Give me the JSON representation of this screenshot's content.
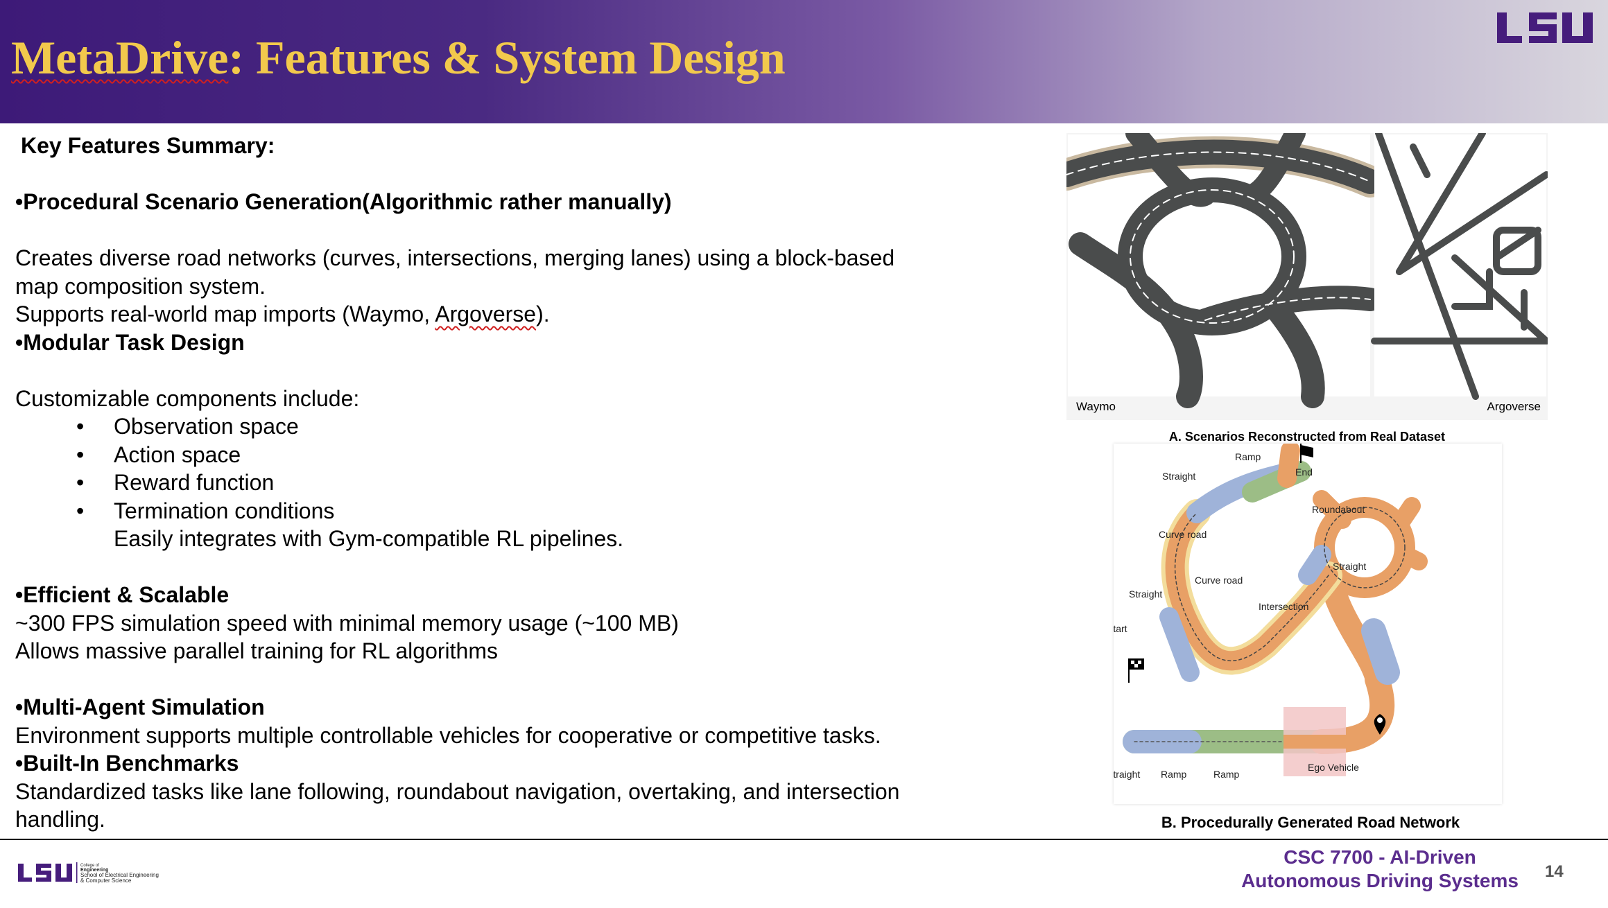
{
  "slide": {
    "title_main": "MetaDrive",
    "title_rest": ": Features & System Design",
    "page_number": "14"
  },
  "content": {
    "heading": "Key Features Summary:",
    "f1_title": "•Procedural Scenario Generation(Algorithmic rather manually)",
    "f1_line1": "Creates diverse road networks (curves, intersections, merging lanes) using a block-based",
    "f1_line2": "map composition system.",
    "f1_line3_pre": "Supports real-world map imports (Waymo, ",
    "f1_line3_spell": "Argoverse",
    "f1_line3_post": ").",
    "f2_title": "•Modular Task Design",
    "f2_intro": "Customizable components include:",
    "f2_items": [
      "Observation space",
      "Action space",
      "Reward function",
      "Termination conditions"
    ],
    "f2_after": "Easily integrates with Gym-compatible RL pipelines.",
    "f3_title": "•Efficient & Scalable",
    "f3_line1": "~300 FPS simulation speed with minimal memory usage (~100 MB)",
    "f3_line2": "Allows massive parallel training for RL algorithms",
    "f4_title": "•Multi-Agent Simulation",
    "f4_line1": "Environment supports multiple controllable vehicles for cooperative or competitive tasks.",
    "f5_title": "•Built-In Benchmarks",
    "f5_line1": "Standardized tasks like lane following, roundabout navigation, overtaking, and intersection",
    "f5_line2": "handling."
  },
  "figure_a": {
    "left_label": "Waymo",
    "right_label": "Argoverse",
    "caption": "A. Scenarios Reconstructed from Real Dataset"
  },
  "figure_b": {
    "labels": {
      "ramp_top": "Ramp",
      "end": "End",
      "straight_top": "Straight",
      "roundabout": "Roundabout",
      "curve_road_1": "Curve road",
      "straight_right": "Straight",
      "curve_road_2": "Curve road",
      "straight_left": "Straight",
      "intersection": "Intersection",
      "start": "Start",
      "straight_bottom": "Straight",
      "ramp_bottom_1": "Ramp",
      "ramp_bottom_2": "Ramp",
      "ego_vehicle": "Ego Vehicle"
    },
    "caption": "B. Procedurally Generated Road Network"
  },
  "footer": {
    "logo_text": "LSU",
    "college_line1": "College of",
    "college_line2": "Engineering",
    "college_line3": "School of Electrical Engineering",
    "college_line4": "& Computer Science",
    "course_line1": "CSC 7700 - AI-Driven",
    "course_line2": "Autonomous Driving Systems"
  },
  "colors": {
    "title": "#f2c94c",
    "lsu_purple": "#461d7c",
    "footer_text": "#5b2d8e"
  }
}
